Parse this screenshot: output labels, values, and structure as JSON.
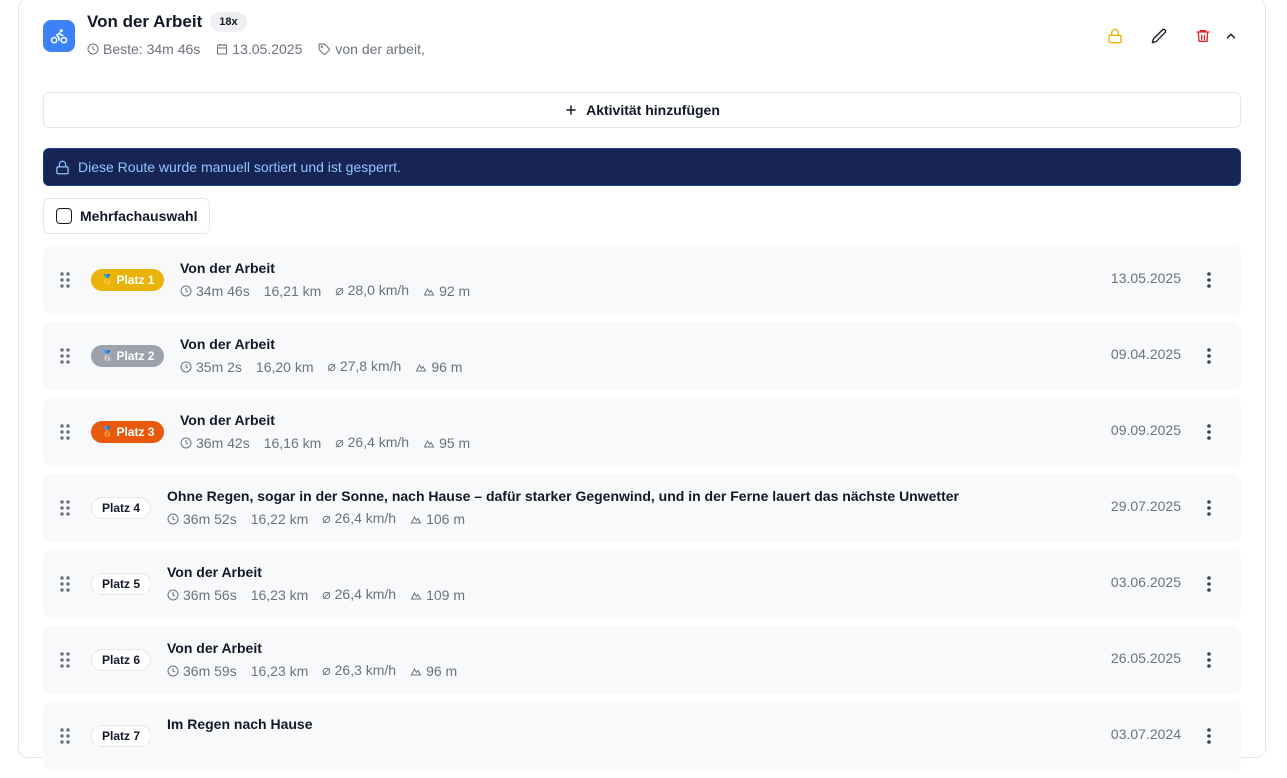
{
  "header": {
    "title": "Von der Arbeit",
    "count": "18x",
    "best": "Beste: 34m 46s",
    "date": "13.05.2025",
    "tag": "von der arbeit,"
  },
  "add_activity": "Aktivität hinzufügen",
  "lock_banner": "Diese Route wurde manuell sortiert und ist gesperrt.",
  "multi_select": "Mehrfachauswahl",
  "colors": {
    "gold": "#eab308",
    "silver": "#9ca3af",
    "bronze": "#ea580c",
    "brand": "#3b82f6",
    "banner": "#172554"
  },
  "rows": [
    {
      "place": "Platz 1",
      "medal": "gold",
      "title": "Von der Arbeit",
      "time": "34m 46s",
      "distance": "16,21 km",
      "speed": "⌀ 28,0 km/h",
      "elevation": "92 m",
      "date": "13.05.2025"
    },
    {
      "place": "Platz 2",
      "medal": "silver",
      "title": "Von der Arbeit",
      "time": "35m 2s",
      "distance": "16,20 km",
      "speed": "⌀ 27,8 km/h",
      "elevation": "96 m",
      "date": "09.04.2025"
    },
    {
      "place": "Platz 3",
      "medal": "bronze",
      "title": "Von der Arbeit",
      "time": "36m 42s",
      "distance": "16,16 km",
      "speed": "⌀ 26,4 km/h",
      "elevation": "95 m",
      "date": "09.09.2025"
    },
    {
      "place": "Platz 4",
      "medal": "plain",
      "title": "Ohne Regen, sogar in der Sonne, nach Hause – dafür starker Gegenwind, und in der Ferne lauert das nächste Unwetter",
      "time": "36m 52s",
      "distance": "16,22 km",
      "speed": "⌀ 26,4 km/h",
      "elevation": "106 m",
      "date": "29.07.2025"
    },
    {
      "place": "Platz 5",
      "medal": "plain",
      "title": "Von der Arbeit",
      "time": "36m 56s",
      "distance": "16,23 km",
      "speed": "⌀ 26,4 km/h",
      "elevation": "109 m",
      "date": "03.06.2025"
    },
    {
      "place": "Platz 6",
      "medal": "plain",
      "title": "Von der Arbeit",
      "time": "36m 59s",
      "distance": "16,23 km",
      "speed": "⌀ 26,3 km/h",
      "elevation": "96 m",
      "date": "26.05.2025"
    },
    {
      "place": "Platz 7",
      "medal": "plain",
      "title": "Im Regen nach Hause",
      "time": "",
      "distance": "",
      "speed": "",
      "elevation": "",
      "date": "03.07.2024"
    }
  ]
}
